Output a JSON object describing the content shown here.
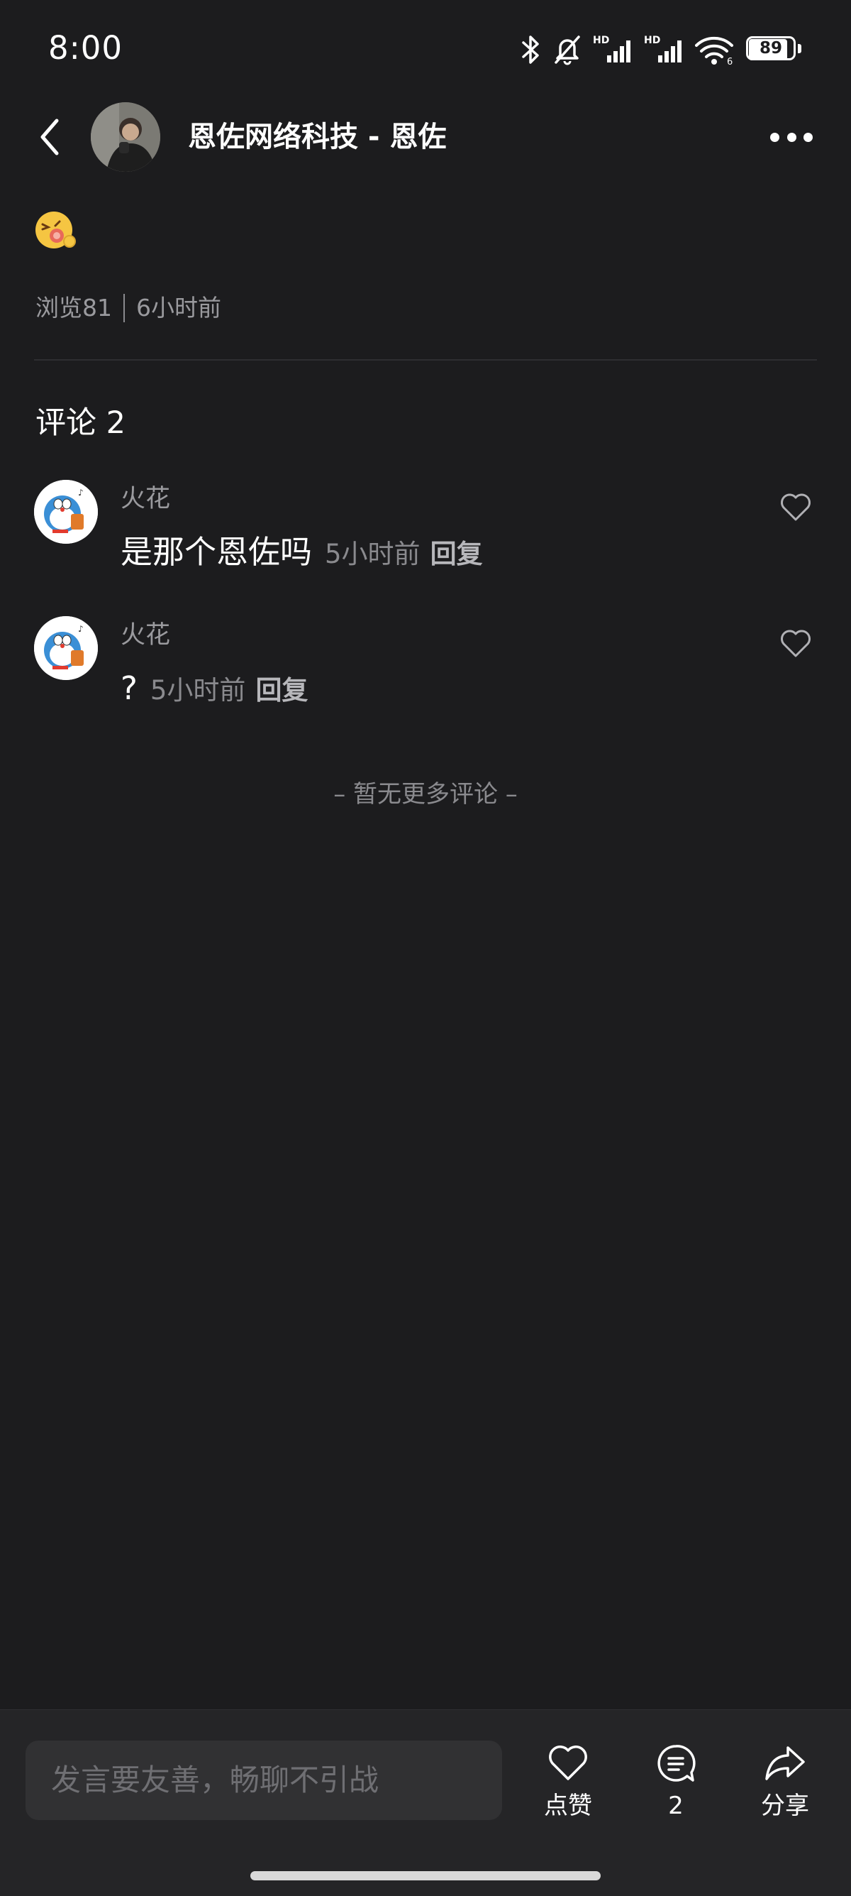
{
  "status_bar": {
    "time": "8:00",
    "battery": "89",
    "icons": [
      "bluetooth-icon",
      "mute-bell-icon",
      "hd-signal-icon",
      "hd-signal-icon",
      "wifi-icon",
      "battery-icon"
    ],
    "wifi_badge": "6",
    "hd_label": "HD"
  },
  "header": {
    "title": "恩佐网络科技 - 恩佐"
  },
  "post": {
    "emoji": "laughing-face-emoji",
    "views": "浏览81",
    "time": "6小时前"
  },
  "comments": {
    "header": "评论 2",
    "items": [
      {
        "name": "火花",
        "text": "是那个恩佐吗",
        "time": "5小时前",
        "reply": "回复"
      },
      {
        "name": "火花",
        "text": "?",
        "time": "5小时前",
        "reply": "回复"
      }
    ],
    "no_more": "– 暂无更多评论 –"
  },
  "bottom": {
    "input_placeholder": "发言要友善，畅聊不引战",
    "like_label": "点赞",
    "comment_count": "2",
    "share_label": "分享"
  },
  "colors": {
    "background": "#1c1c1e",
    "bottom_bar": "#252527",
    "input": "#313133",
    "muted_text": "#8a8a8e"
  }
}
